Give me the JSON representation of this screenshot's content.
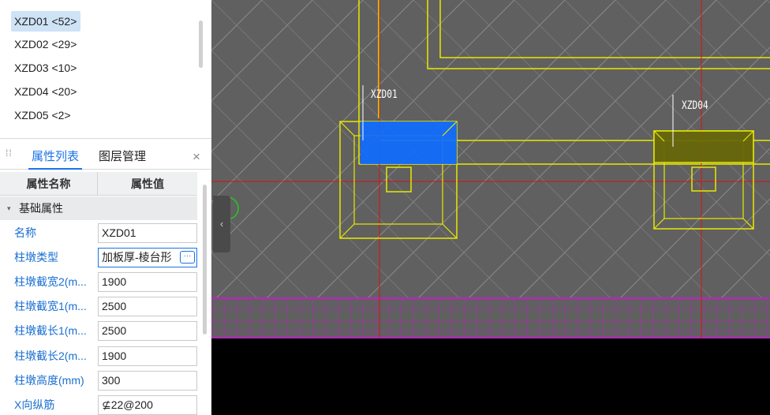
{
  "component_list": {
    "items": [
      {
        "label": "XZD01 <52>",
        "selected": true
      },
      {
        "label": "XZD02 <29>",
        "selected": false
      },
      {
        "label": "XZD03 <10>",
        "selected": false
      },
      {
        "label": "XZD04 <20>",
        "selected": false
      },
      {
        "label": "XZD05 <2>",
        "selected": false
      }
    ]
  },
  "property_panel": {
    "tabs": [
      {
        "label": "属性列表",
        "active": true
      },
      {
        "label": "图层管理",
        "active": false
      }
    ],
    "close_label": "×",
    "header": {
      "name": "属性名称",
      "value": "属性值"
    },
    "group": {
      "caret": "▾",
      "label": "基础属性"
    },
    "rows": [
      {
        "name": "名称",
        "value": "XZD01"
      },
      {
        "name": "柱墩类型",
        "value": "加板厚-棱台形"
      },
      {
        "name": "柱墩截宽2(m...",
        "value": "1900"
      },
      {
        "name": "柱墩截宽1(m...",
        "value": "2500"
      },
      {
        "name": "柱墩截长1(m...",
        "value": "2500"
      },
      {
        "name": "柱墩截长2(m...",
        "value": "1900"
      },
      {
        "name": "柱墩高度(mm)",
        "value": "300"
      },
      {
        "name": "X向纵筋",
        "value": "⊈22@200"
      }
    ],
    "more_label": "···"
  },
  "canvas": {
    "labels": [
      {
        "text": "XZD01"
      },
      {
        "text": "XZD04"
      }
    ],
    "collapse_label": "‹",
    "colors": {
      "background": "#606060",
      "yellow": "#e8e800",
      "red": "#dd1111",
      "magenta": "#c020c8",
      "selection_blue": "#0f6cff",
      "olive_fill": "#66660a"
    }
  }
}
